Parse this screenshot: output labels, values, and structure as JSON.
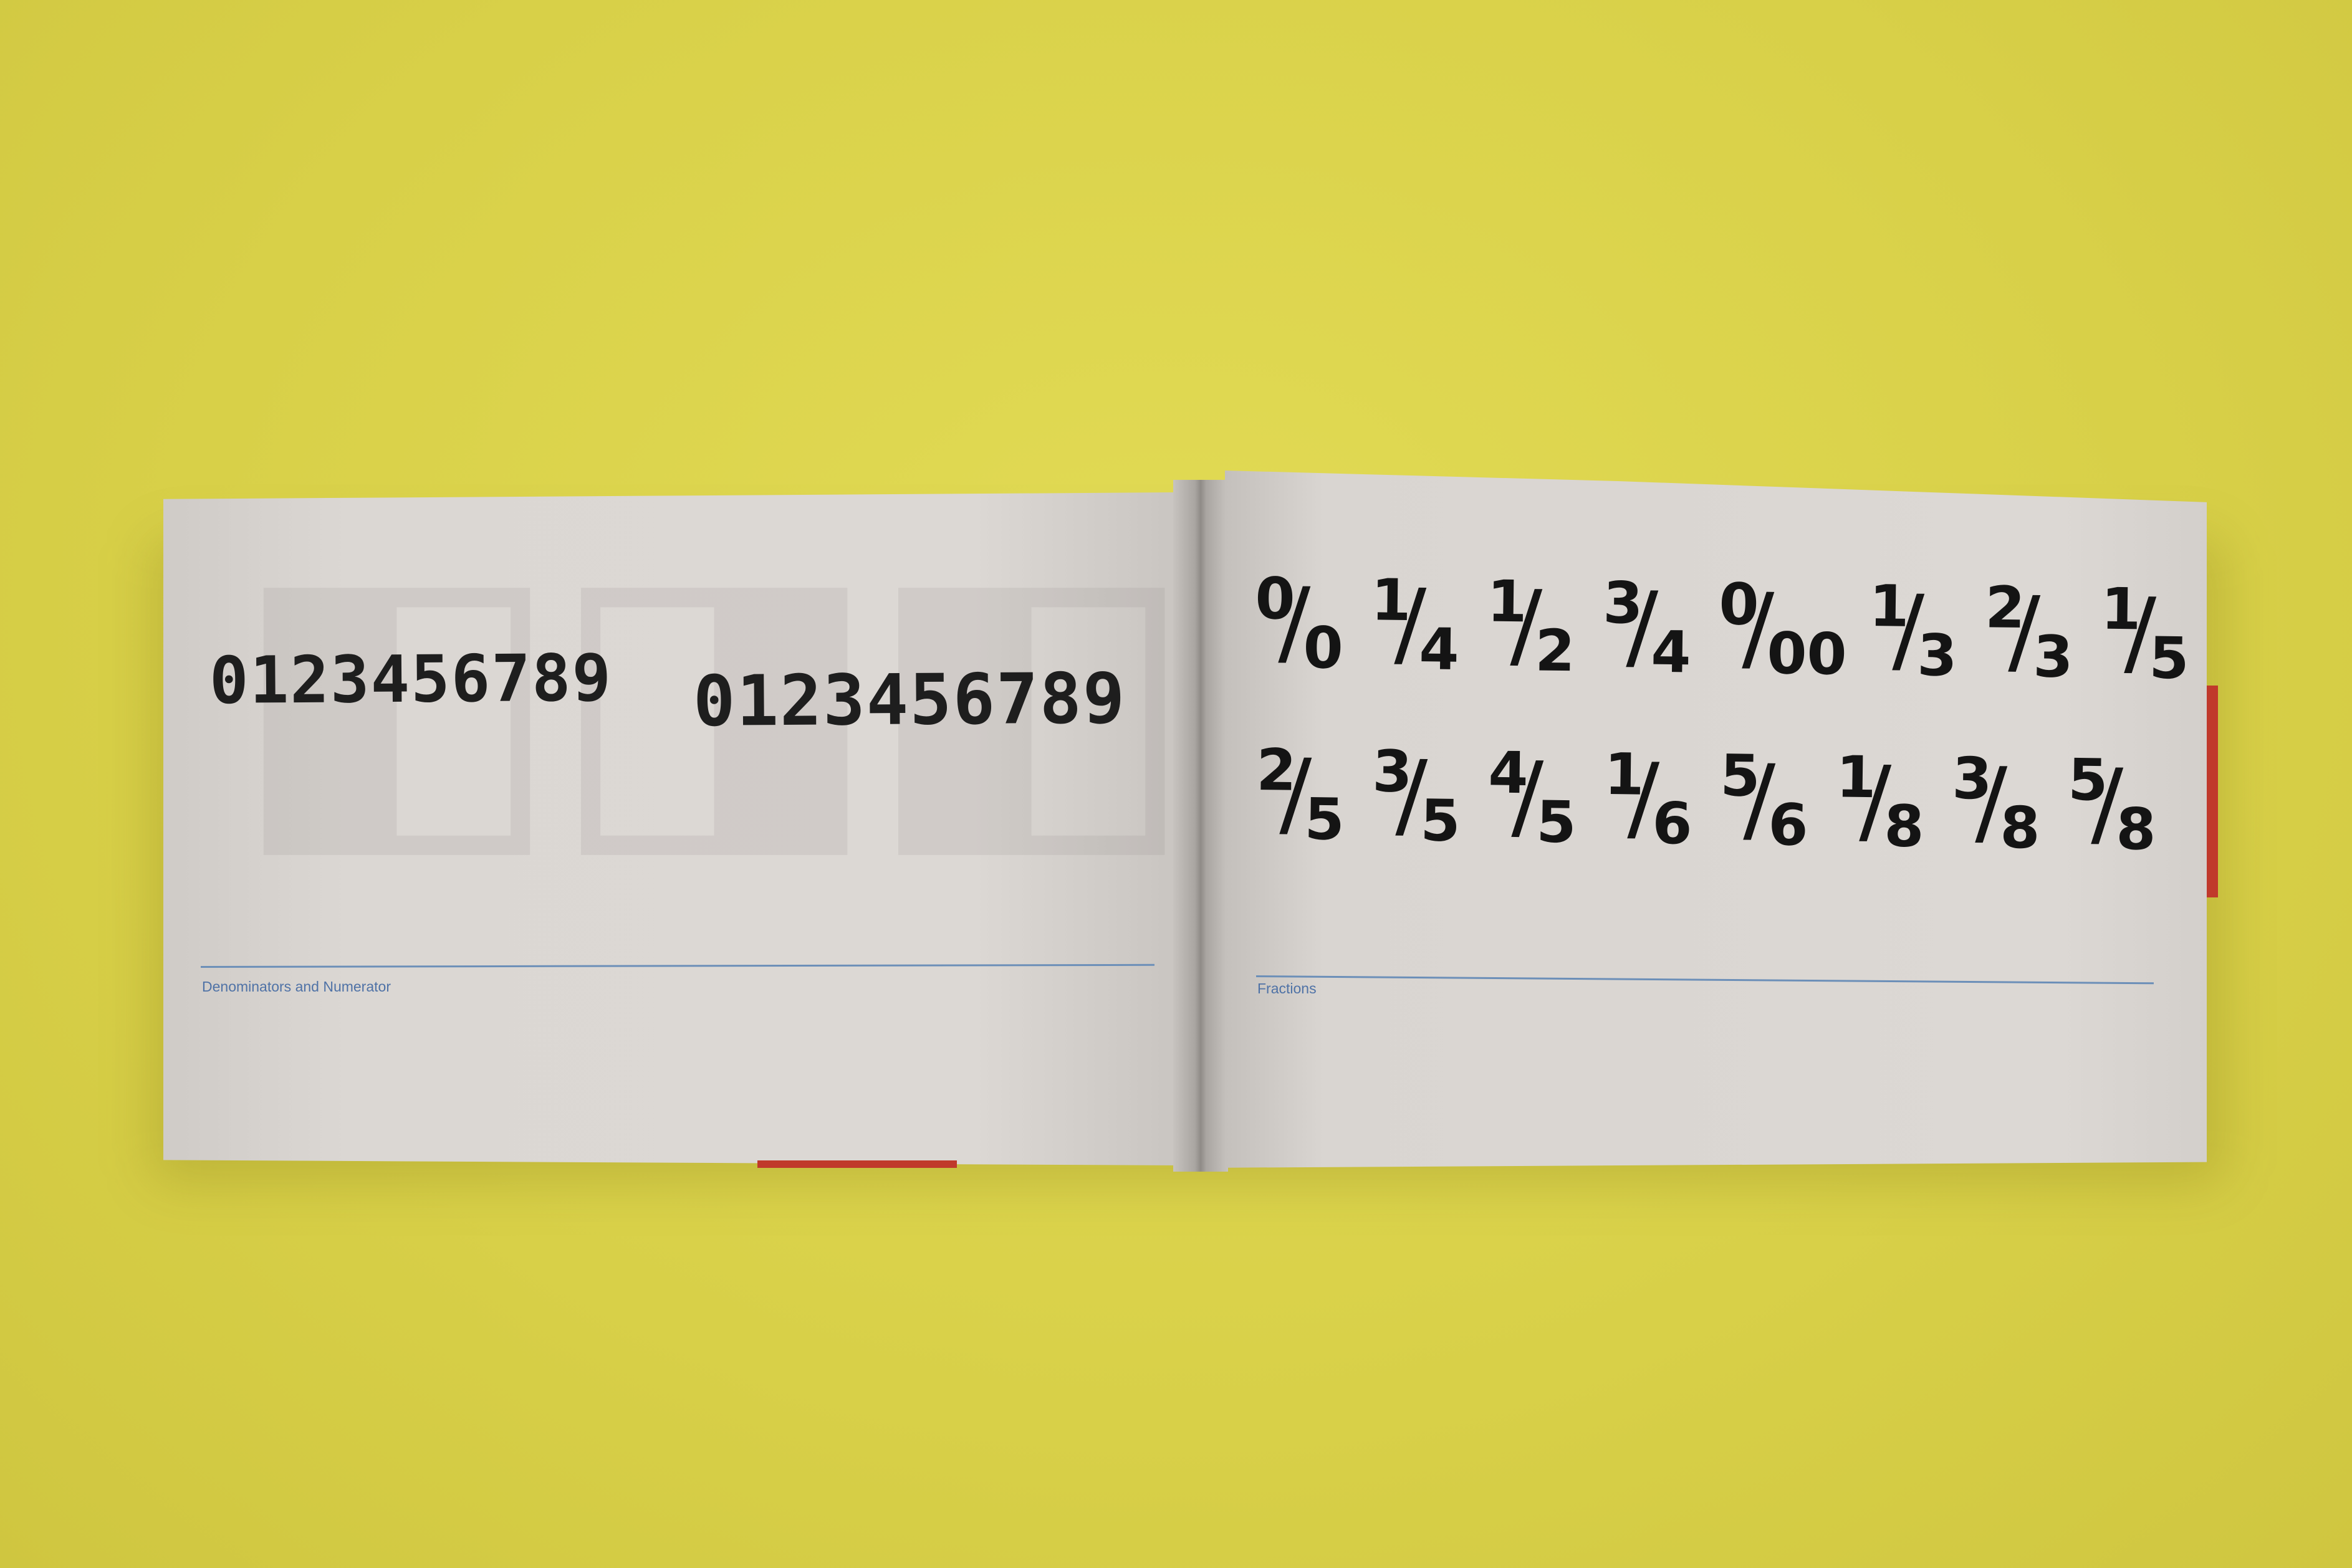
{
  "left_page": {
    "numerals_small": "0123456789",
    "numerals_large": "0123456789",
    "caption": "Denominators and Numerator"
  },
  "right_page": {
    "caption": "Fractions",
    "fractions_row1": [
      {
        "num": "0",
        "den": "0"
      },
      {
        "num": "1",
        "den": "4"
      },
      {
        "num": "1",
        "den": "2"
      },
      {
        "num": "3",
        "den": "4"
      },
      {
        "num": "0",
        "den": "00"
      },
      {
        "num": "1",
        "den": "3"
      },
      {
        "num": "2",
        "den": "3"
      },
      {
        "num": "1",
        "den": "5"
      }
    ],
    "fractions_row2": [
      {
        "num": "2",
        "den": "5"
      },
      {
        "num": "3",
        "den": "5"
      },
      {
        "num": "4",
        "den": "5"
      },
      {
        "num": "1",
        "den": "6"
      },
      {
        "num": "5",
        "den": "6"
      },
      {
        "num": "1",
        "den": "8"
      },
      {
        "num": "3",
        "den": "8"
      },
      {
        "num": "5",
        "den": "8"
      }
    ]
  },
  "colors": {
    "background": "#dcd54c",
    "paper": "#d9d5d1",
    "ink": "#1e1e1e",
    "rule": "#6c8fb8",
    "accent_red": "#c0392b"
  }
}
